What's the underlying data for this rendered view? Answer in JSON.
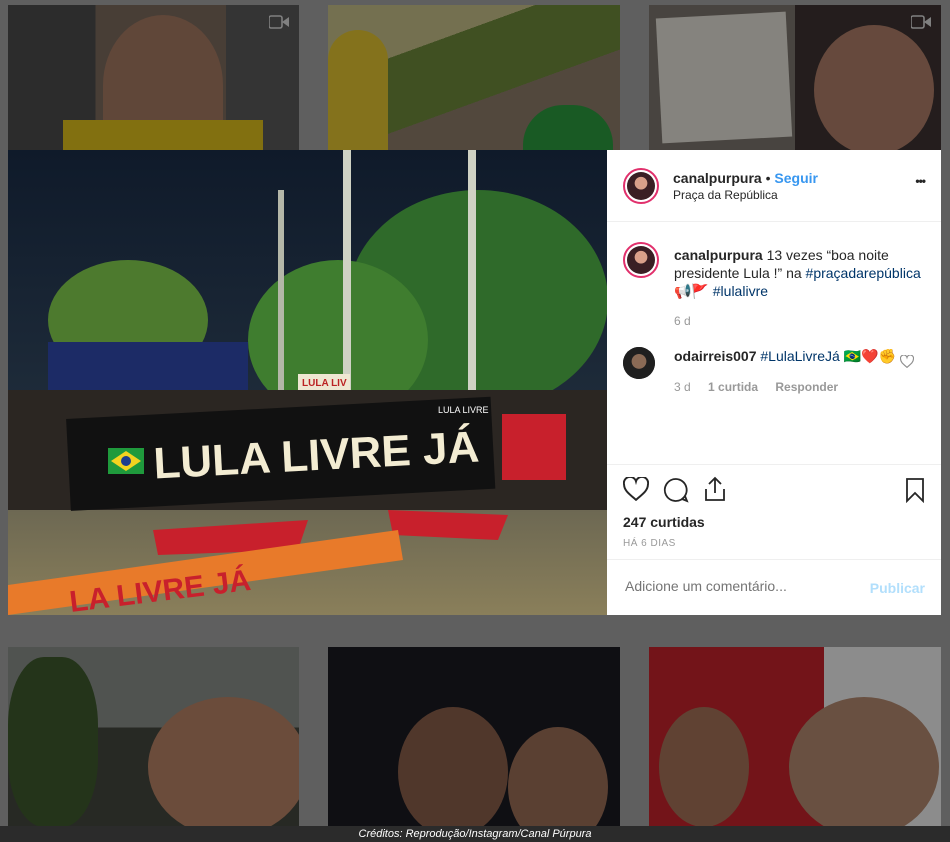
{
  "post": {
    "username": "canalpurpura",
    "separator": "•",
    "follow_label": "Seguir",
    "location": "Praça da República",
    "more_label": "•••",
    "caption_user": "canalpurpura",
    "caption_text": "13 vezes “boa noite presidente Lula !” na",
    "caption_tag1": "#praçadarepública",
    "caption_emoji": "📢🚩",
    "caption_tag2": "#lulalivre",
    "caption_age": "6 d",
    "comment": {
      "username": "odairreis007",
      "tag": "#LulaLivreJá",
      "emoji": "🇧🇷❤️✊",
      "age": "3 d",
      "likes": "1 curtida",
      "reply_label": "Responder"
    },
    "likes_count": "247 curtidas",
    "timestamp": "HÁ 6 DIAS",
    "comment_placeholder": "Adicione um comentário...",
    "publish_label": "Publicar"
  },
  "photo": {
    "banner_text": "LULA  LIVRE  JÁ",
    "sign_text": "LULA LIV",
    "flag_text": "LULA LIVRE",
    "floor_text": "LA LIVRE JÁ"
  },
  "credit": "Créditos: Reprodução/Instagram/Canal Púrpura",
  "colors": {
    "accent": "#3897f0",
    "brand_ring": "#e1306c",
    "banner": "#111111",
    "red": "#c8202c"
  }
}
